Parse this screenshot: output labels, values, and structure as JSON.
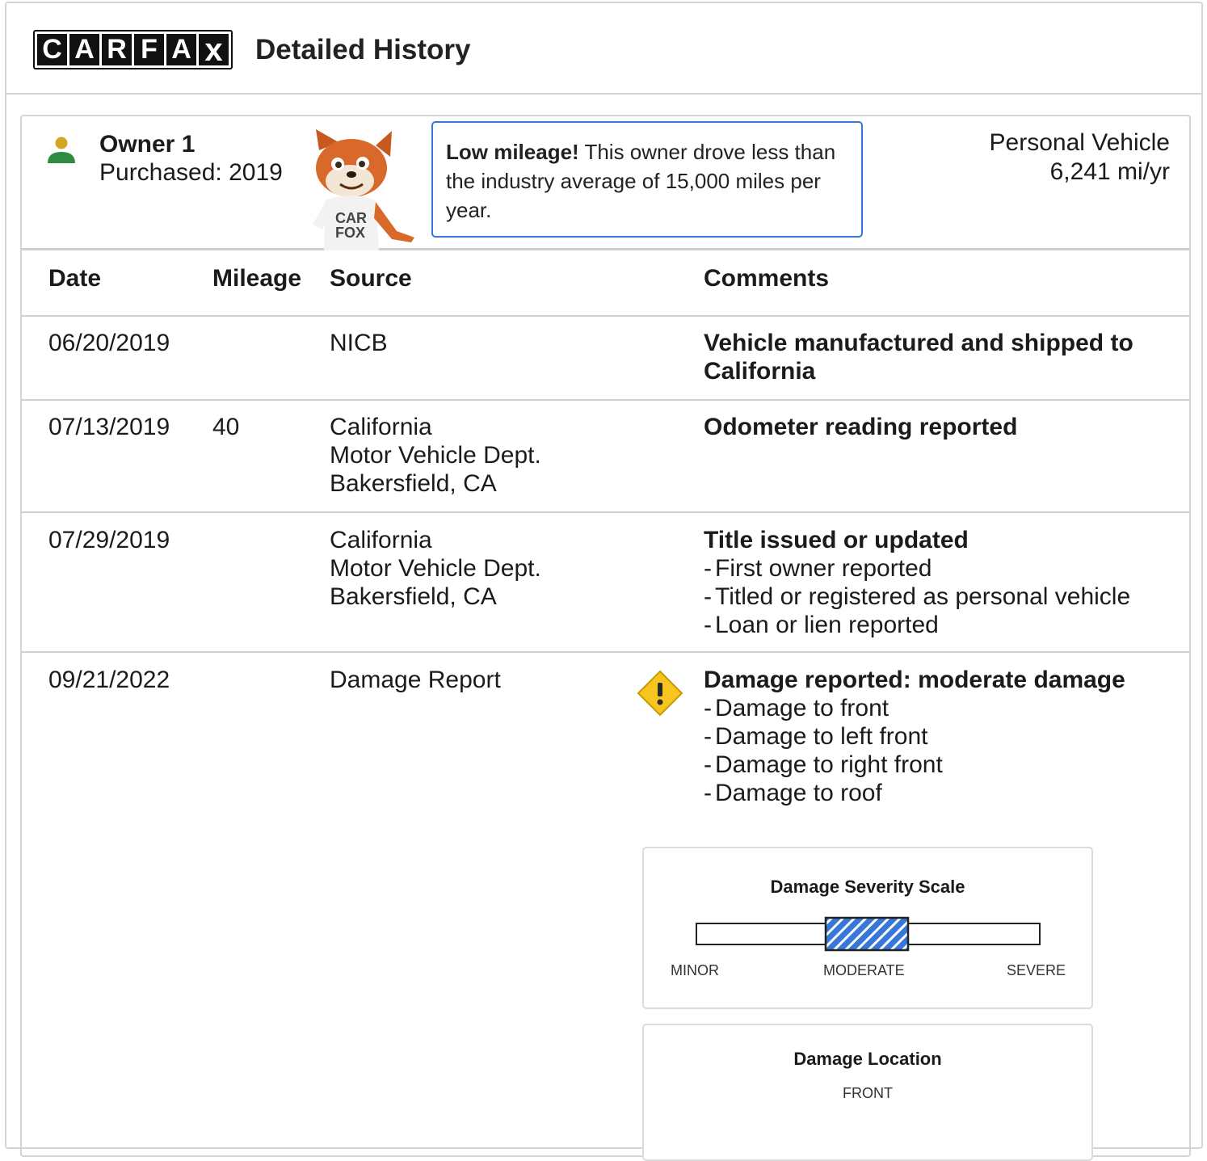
{
  "header": {
    "logo_letters": [
      "C",
      "A",
      "R",
      "F",
      "A",
      "X"
    ],
    "title": "Detailed History"
  },
  "owner": {
    "name": "Owner 1",
    "purchased": "Purchased: 2019",
    "mascot_shirt": "CAR FOX",
    "tip_bold": "Low mileage!",
    "tip_text": " This owner drove less than the industry average of 15,000 miles per year.",
    "vehicle_type": "Personal Vehicle",
    "annual_miles": "6,241 mi/yr"
  },
  "table": {
    "headers": {
      "date": "Date",
      "mileage": "Mileage",
      "source": "Source",
      "comments": "Comments"
    },
    "rows": [
      {
        "date": "06/20/2019",
        "mileage": "",
        "source": [
          "NICB"
        ],
        "comment_title": "Vehicle manufactured and shipped to California",
        "comment_items": []
      },
      {
        "date": "07/13/2019",
        "mileage": "40",
        "source": [
          "California",
          "Motor Vehicle Dept.",
          "Bakersfield, CA"
        ],
        "comment_title": "Odometer reading reported",
        "comment_items": []
      },
      {
        "date": "07/29/2019",
        "mileage": "",
        "source": [
          "California",
          "Motor Vehicle Dept.",
          "Bakersfield, CA"
        ],
        "comment_title": "Title issued or updated",
        "comment_items": [
          "First owner reported",
          "Titled or registered as personal vehicle",
          "Loan or lien reported"
        ]
      },
      {
        "date": "09/21/2022",
        "mileage": "",
        "source": [
          "Damage Report"
        ],
        "comment_title": "Damage reported: moderate damage",
        "comment_items": [
          "Damage to front",
          "Damage to left front",
          "Damage to right front",
          "Damage to roof"
        ]
      }
    ],
    "bullet_dash": "-"
  },
  "damage_scale": {
    "title": "Damage Severity Scale",
    "labels": [
      "MINOR",
      "MODERATE",
      "SEVERE"
    ],
    "selected": "MODERATE"
  },
  "damage_location": {
    "title": "Damage Location",
    "value": "FRONT"
  },
  "colors": {
    "accent_blue": "#3777d8",
    "warning_yellow": "#f7c520",
    "owner_icon_head": "#d4a520",
    "owner_icon_body": "#2e8b3f"
  }
}
